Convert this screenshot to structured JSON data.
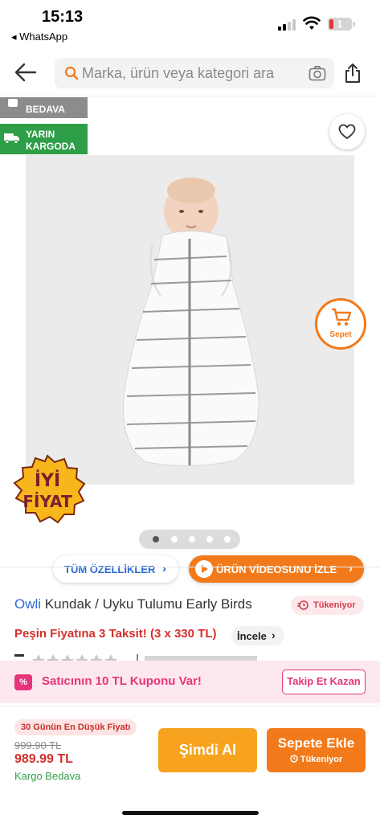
{
  "status_bar": {
    "time": "15:13",
    "back_app": "◂ WhatsApp",
    "battery": "1"
  },
  "search": {
    "placeholder": "Marka, ürün veya kategori ara"
  },
  "gallery": {
    "badge_free": "BEDAVA",
    "badge_tomorrow_line1": "YARIN",
    "badge_tomorrow_line2": "KARGODA",
    "cart_fab_label": "Sepet",
    "good_price_line1": "İYİ",
    "good_price_line2": "FİYAT",
    "image_count": 5,
    "active_image": 1,
    "features_button": "TÜM ÖZELLİKLER",
    "video_button": "ÜRÜN VİDEOSUNU İZLE"
  },
  "product": {
    "brand": "Owli",
    "name": "Kundak / Uyku Tulumu Early Birds",
    "stock_status": "Tükeniyor",
    "installment": "Peşin Fiyatına 3 Taksit! (3 x 330 TL)",
    "inspect_label": "İncele"
  },
  "coupon": {
    "icon_text": "%",
    "text": "Satıcının 10 TL Kuponu Var!",
    "button": "Takip Et Kazan"
  },
  "bottom": {
    "lowest_badge": "30 Günün En Düşük Fiyatı",
    "old_price": "999.90 TL",
    "price": "989.99 TL",
    "shipping": "Kargo Bedava",
    "buy_now": "Şimdi Al",
    "add_to_cart": "Sepete Ekle",
    "add_to_cart_sub": "Tükeniyor"
  },
  "colors": {
    "brand_orange": "#f27a1a",
    "buy_now_yellow": "#f7a31f",
    "link_blue": "#2b6ad3",
    "price_red": "#d5302c",
    "coupon_pink": "#e6357a",
    "shipping_green": "#2e9e48"
  }
}
